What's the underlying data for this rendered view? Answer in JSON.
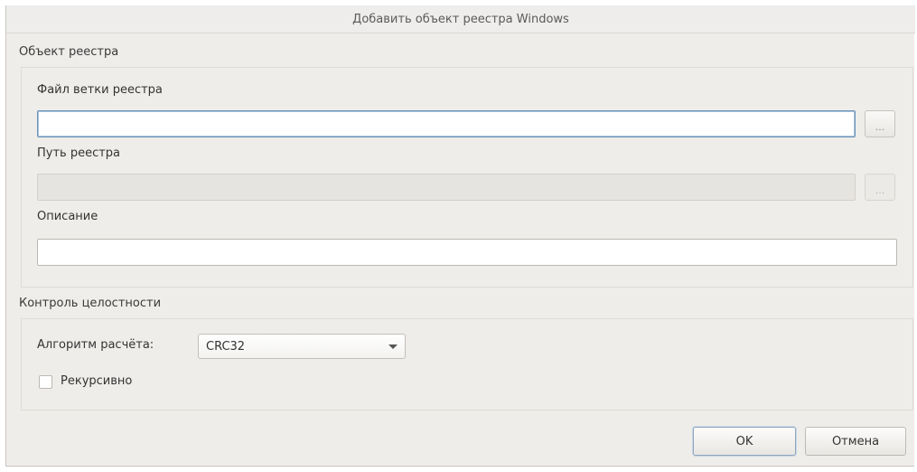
{
  "window": {
    "title": "Добавить объект реестра Windows"
  },
  "registry_object": {
    "section_title": "Объект реестра",
    "hive_file": {
      "label": "Файл ветки реестра",
      "value": "",
      "browse_label": "..."
    },
    "registry_path": {
      "label": "Путь реестра",
      "value": "",
      "browse_label": "..."
    },
    "description": {
      "label": "Описание",
      "value": ""
    }
  },
  "integrity_control": {
    "section_title": "Контроль целостности",
    "algorithm_label": "Алгоритм расчёта:",
    "algorithm_value": "CRC32",
    "recursive_label": "Рекурсивно",
    "recursive_checked": false
  },
  "buttons": {
    "ok_label": "OK",
    "cancel_label": "Отмена"
  }
}
